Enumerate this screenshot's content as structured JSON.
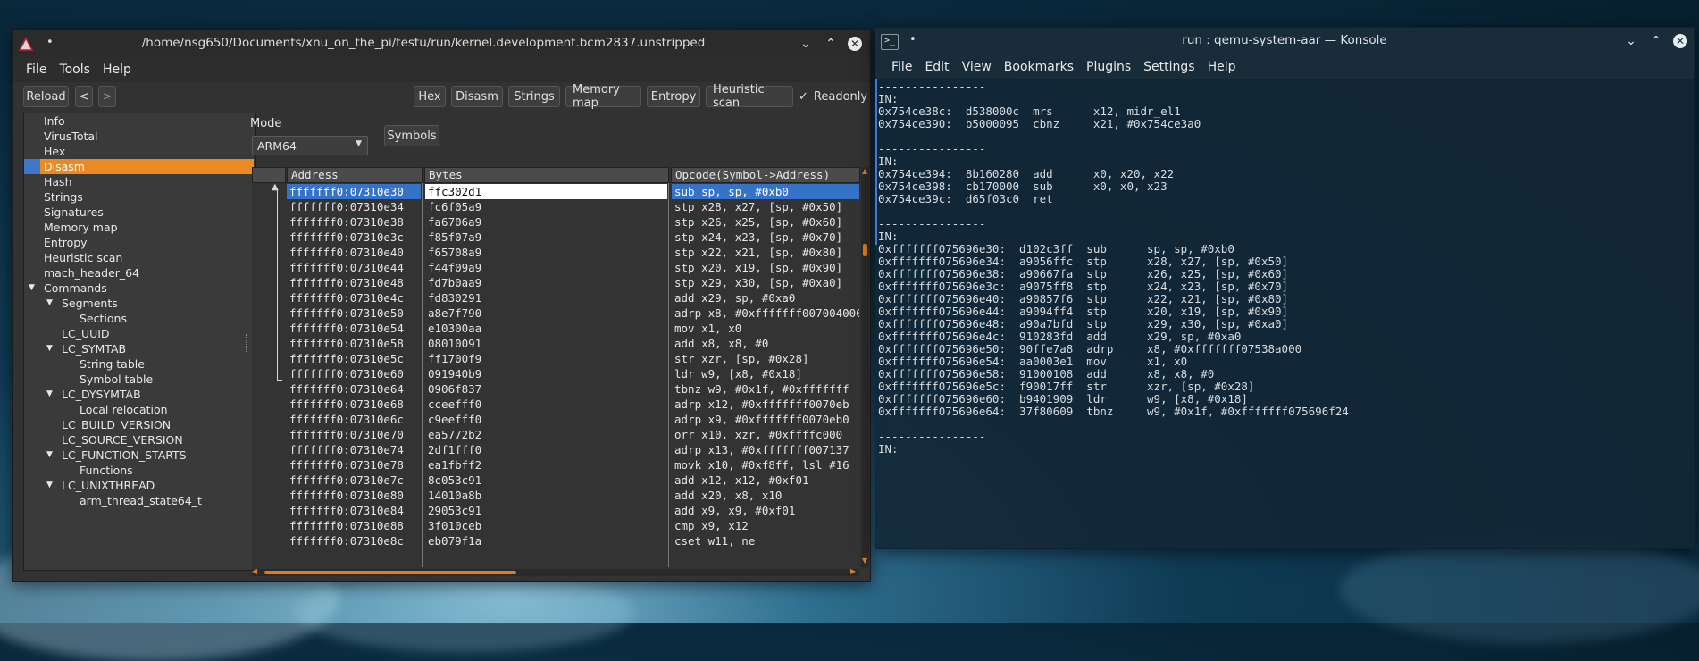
{
  "left_window": {
    "title": "/home/nsg650/Documents/xnu_on_the_pi/testu/run/kernel.development.bcm2837.unstripped",
    "title_dot": "•",
    "menu": [
      "File",
      "Tools",
      "Help"
    ],
    "toolbar": {
      "reload": "Reload",
      "back": "<",
      "forward": ">",
      "hex": "Hex",
      "disasm": "Disasm",
      "strings": "Strings",
      "memory_map": "Memory map",
      "entropy": "Entropy",
      "heuristic_scan": "Heuristic scan",
      "readonly_check": "✓",
      "readonly": "Readonly"
    },
    "tree": [
      {
        "label": "Info"
      },
      {
        "label": "VirusTotal"
      },
      {
        "label": "Hex"
      },
      {
        "label": "Disasm",
        "selected": true
      },
      {
        "label": "Hash"
      },
      {
        "label": "Strings"
      },
      {
        "label": "Signatures"
      },
      {
        "label": "Memory map"
      },
      {
        "label": "Entropy"
      },
      {
        "label": "Heuristic scan"
      },
      {
        "label": "mach_header_64"
      },
      {
        "label": "Commands"
      },
      {
        "label": "Segments"
      },
      {
        "label": "Sections"
      },
      {
        "label": "LC_UUID"
      },
      {
        "label": "LC_SYMTAB"
      },
      {
        "label": "String table"
      },
      {
        "label": "Symbol table"
      },
      {
        "label": "LC_DYSYMTAB"
      },
      {
        "label": "Local relocation"
      },
      {
        "label": "LC_BUILD_VERSION"
      },
      {
        "label": "LC_SOURCE_VERSION"
      },
      {
        "label": "LC_FUNCTION_STARTS"
      },
      {
        "label": "Functions"
      },
      {
        "label": "LC_UNIXTHREAD"
      },
      {
        "label": "arm_thread_state64_t"
      }
    ],
    "mode_label": "Mode",
    "mode_value": "ARM64",
    "symbols_button": "Symbols",
    "columns": [
      "Address",
      "Bytes",
      "Opcode(Symbol->Address)"
    ],
    "rows": [
      {
        "address": "fffffff0:07310e30",
        "bytes": "ffc302d1",
        "opcode": "sub sp, sp, #0xb0"
      },
      {
        "address": "fffffff0:07310e34",
        "bytes": "fc6f05a9",
        "opcode": "stp x28, x27, [sp, #0x50]"
      },
      {
        "address": "fffffff0:07310e38",
        "bytes": "fa6706a9",
        "opcode": "stp x26, x25, [sp, #0x60]"
      },
      {
        "address": "fffffff0:07310e3c",
        "bytes": "f85f07a9",
        "opcode": "stp x24, x23, [sp, #0x70]"
      },
      {
        "address": "fffffff0:07310e40",
        "bytes": "f65708a9",
        "opcode": "stp x22, x21, [sp, #0x80]"
      },
      {
        "address": "fffffff0:07310e44",
        "bytes": "f44f09a9",
        "opcode": "stp x20, x19, [sp, #0x90]"
      },
      {
        "address": "fffffff0:07310e48",
        "bytes": "fd7b0aa9",
        "opcode": "stp x29, x30, [sp, #0xa0]"
      },
      {
        "address": "fffffff0:07310e4c",
        "bytes": "fd830291",
        "opcode": "add x29, sp, #0xa0"
      },
      {
        "address": "fffffff0:07310e50",
        "bytes": "a8e7f790",
        "opcode": "adrp x8, #0xfffffff007004000"
      },
      {
        "address": "fffffff0:07310e54",
        "bytes": "e10300aa",
        "opcode": "mov x1, x0"
      },
      {
        "address": "fffffff0:07310e58",
        "bytes": "08010091",
        "opcode": "add x8, x8, #0"
      },
      {
        "address": "fffffff0:07310e5c",
        "bytes": "ff1700f9",
        "opcode": "str xzr, [sp, #0x28]"
      },
      {
        "address": "fffffff0:07310e60",
        "bytes": "091940b9",
        "opcode": "ldr w9, [x8, #0x18]"
      },
      {
        "address": "fffffff0:07310e64",
        "bytes": "0906f837",
        "opcode": "tbnz w9, #0x1f, #0xfffffff"
      },
      {
        "address": "fffffff0:07310e68",
        "bytes": "cceefff0",
        "opcode": "adrp x12, #0xfffffff0070eb"
      },
      {
        "address": "fffffff0:07310e6c",
        "bytes": "c9eefff0",
        "opcode": "adrp x9, #0xfffffff0070eb0"
      },
      {
        "address": "fffffff0:07310e70",
        "bytes": "ea5772b2",
        "opcode": "orr x10, xzr, #0xffffc000"
      },
      {
        "address": "fffffff0:07310e74",
        "bytes": "2df1fff0",
        "opcode": "adrp x13, #0xfffffff007137"
      },
      {
        "address": "fffffff0:07310e78",
        "bytes": "ea1fbff2",
        "opcode": "movk x10, #0xf8ff, lsl #16"
      },
      {
        "address": "fffffff0:07310e7c",
        "bytes": "8c053c91",
        "opcode": "add x12, x12, #0xf01"
      },
      {
        "address": "fffffff0:07310e80",
        "bytes": "14010a8b",
        "opcode": "add x20, x8, x10"
      },
      {
        "address": "fffffff0:07310e84",
        "bytes": "29053c91",
        "opcode": "add x9, x9, #0xf01"
      },
      {
        "address": "fffffff0:07310e88",
        "bytes": "3f010ceb",
        "opcode": "cmp x9, x12"
      },
      {
        "address": "fffffff0:07310e8c",
        "bytes": "eb079f1a",
        "opcode": "cset w11, ne"
      }
    ]
  },
  "right_window": {
    "title": "run : qemu-system-aar — Konsole",
    "title_dot": "•",
    "menu": [
      "File",
      "Edit",
      "View",
      "Bookmarks",
      "Plugins",
      "Settings",
      "Help"
    ],
    "lines": [
      "----------------",
      "IN:",
      "0x754ce38c:  d538000c  mrs      x12, midr_el1",
      "0x754ce390:  b5000095  cbnz     x21, #0x754ce3a0",
      "",
      "----------------",
      "IN:",
      "0x754ce394:  8b160280  add      x0, x20, x22",
      "0x754ce398:  cb170000  sub      x0, x0, x23",
      "0x754ce39c:  d65f03c0  ret",
      "",
      "----------------",
      "IN:",
      "0xfffffff075696e30:  d102c3ff  sub      sp, sp, #0xb0",
      "0xfffffff075696e34:  a9056ffc  stp      x28, x27, [sp, #0x50]",
      "0xfffffff075696e38:  a90667fa  stp      x26, x25, [sp, #0x60]",
      "0xfffffff075696e3c:  a9075ff8  stp      x24, x23, [sp, #0x70]",
      "0xfffffff075696e40:  a90857f6  stp      x22, x21, [sp, #0x80]",
      "0xfffffff075696e44:  a9094ff4  stp      x20, x19, [sp, #0x90]",
      "0xfffffff075696e48:  a90a7bfd  stp      x29, x30, [sp, #0xa0]",
      "0xfffffff075696e4c:  910283fd  add      x29, sp, #0xa0",
      "0xfffffff075696e50:  90ffe7a8  adrp     x8, #0xfffffff07538a000",
      "0xfffffff075696e54:  aa0003e1  mov      x1, x0",
      "0xfffffff075696e58:  91000108  add      x8, x8, #0",
      "0xfffffff075696e5c:  f90017ff  str      xzr, [sp, #0x28]",
      "0xfffffff075696e60:  b9401909  ldr      w9, [x8, #0x18]",
      "0xfffffff075696e64:  37f80609  tbnz     w9, #0x1f, #0xfffffff075696f24",
      "",
      "----------------",
      "IN:"
    ]
  }
}
